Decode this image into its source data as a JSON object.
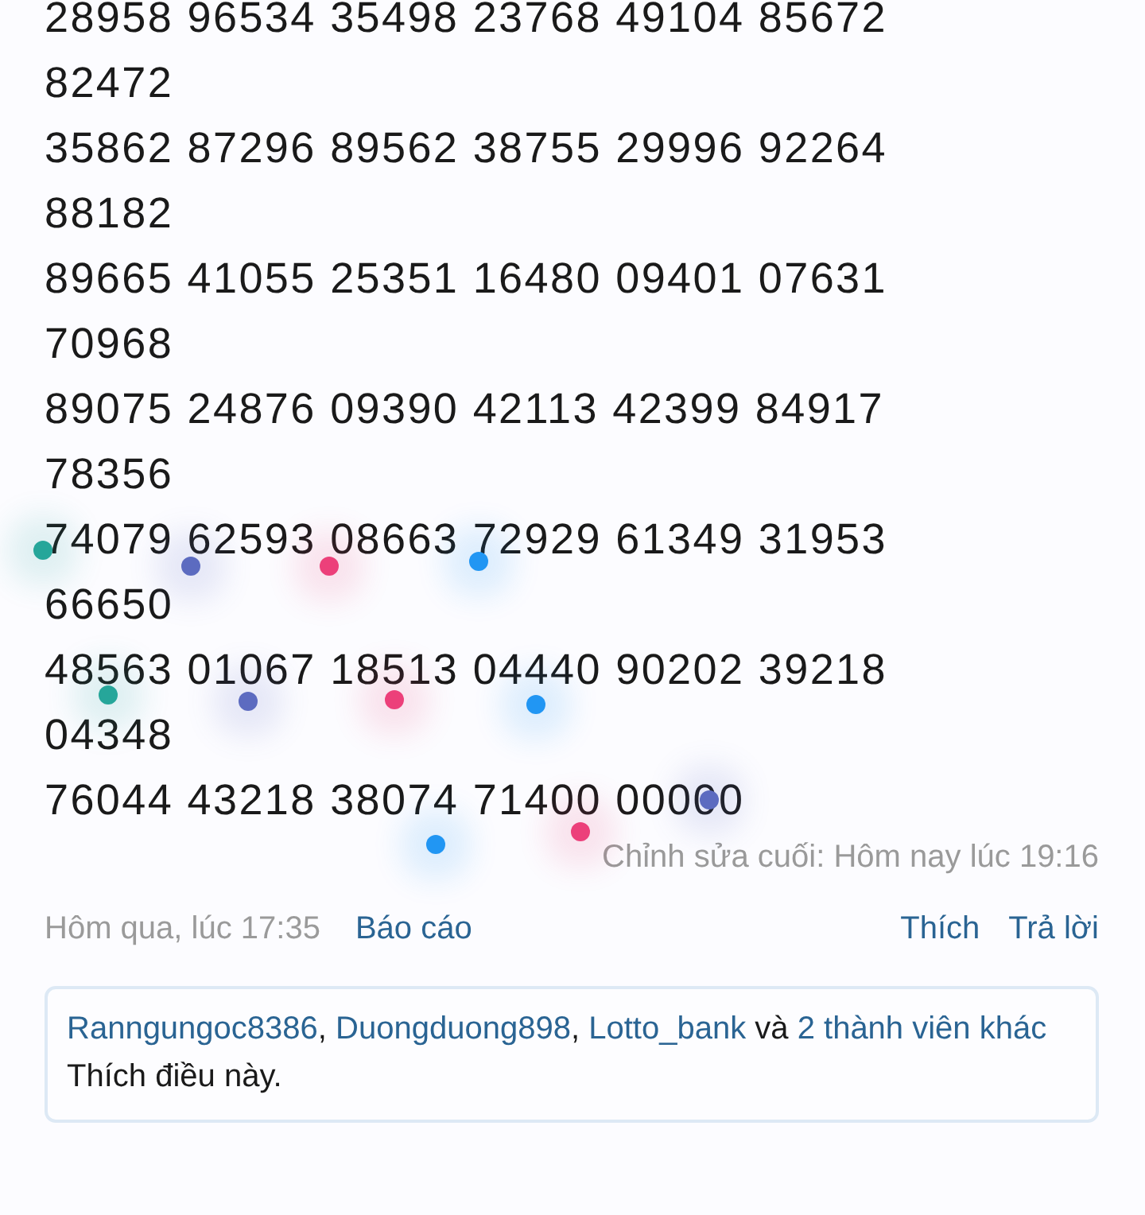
{
  "number_lines": [
    "28958 96534 35498 23768 49104 85672",
    "82472",
    "35862 87296 89562 38755 29996 92264",
    "88182",
    "89665 41055 25351 16480 09401 07631",
    "70968",
    "89075 24876 09390 42113 42399 84917",
    "78356",
    "74079 62593 08663 72929 61349 31953",
    "66650",
    "48563 01067 18513 04440 90202 39218",
    "04348",
    "76044 43218 38074 71400 00000"
  ],
  "touch_marks": [
    {
      "color": "#26a69a"
    },
    {
      "color": "#5c6bc0"
    },
    {
      "color": "#ec407a"
    },
    {
      "color": "#2196f3"
    },
    {
      "color": "#26a69a"
    },
    {
      "color": "#5c6bc0"
    },
    {
      "color": "#ec407a"
    },
    {
      "color": "#2196f3"
    },
    {
      "color": "#2196f3"
    },
    {
      "color": "#ec407a"
    },
    {
      "color": "#5c6bc0"
    }
  ],
  "last_edited": "Chỉnh sửa cuối: Hôm nay lúc 19:16",
  "post_time": "Hôm qua, lúc 17:35",
  "report_link": "Báo cáo",
  "like_button": "Thích",
  "reply_button": "Trả lời",
  "likes_summary": [
    {
      "text": "Ranngungoc8386",
      "kind": "link"
    },
    {
      "text": ", ",
      "kind": "text"
    },
    {
      "text": "Duongduong898",
      "kind": "link"
    },
    {
      "text": ", ",
      "kind": "text"
    },
    {
      "text": "Lotto_bank",
      "kind": "link"
    },
    {
      "text": " và ",
      "kind": "text"
    },
    {
      "text": "2 thành viên",
      "kind": "link"
    },
    {
      "text": "khác",
      "kind": "link"
    },
    {
      "text": " Thích điều này.",
      "kind": "text"
    }
  ]
}
